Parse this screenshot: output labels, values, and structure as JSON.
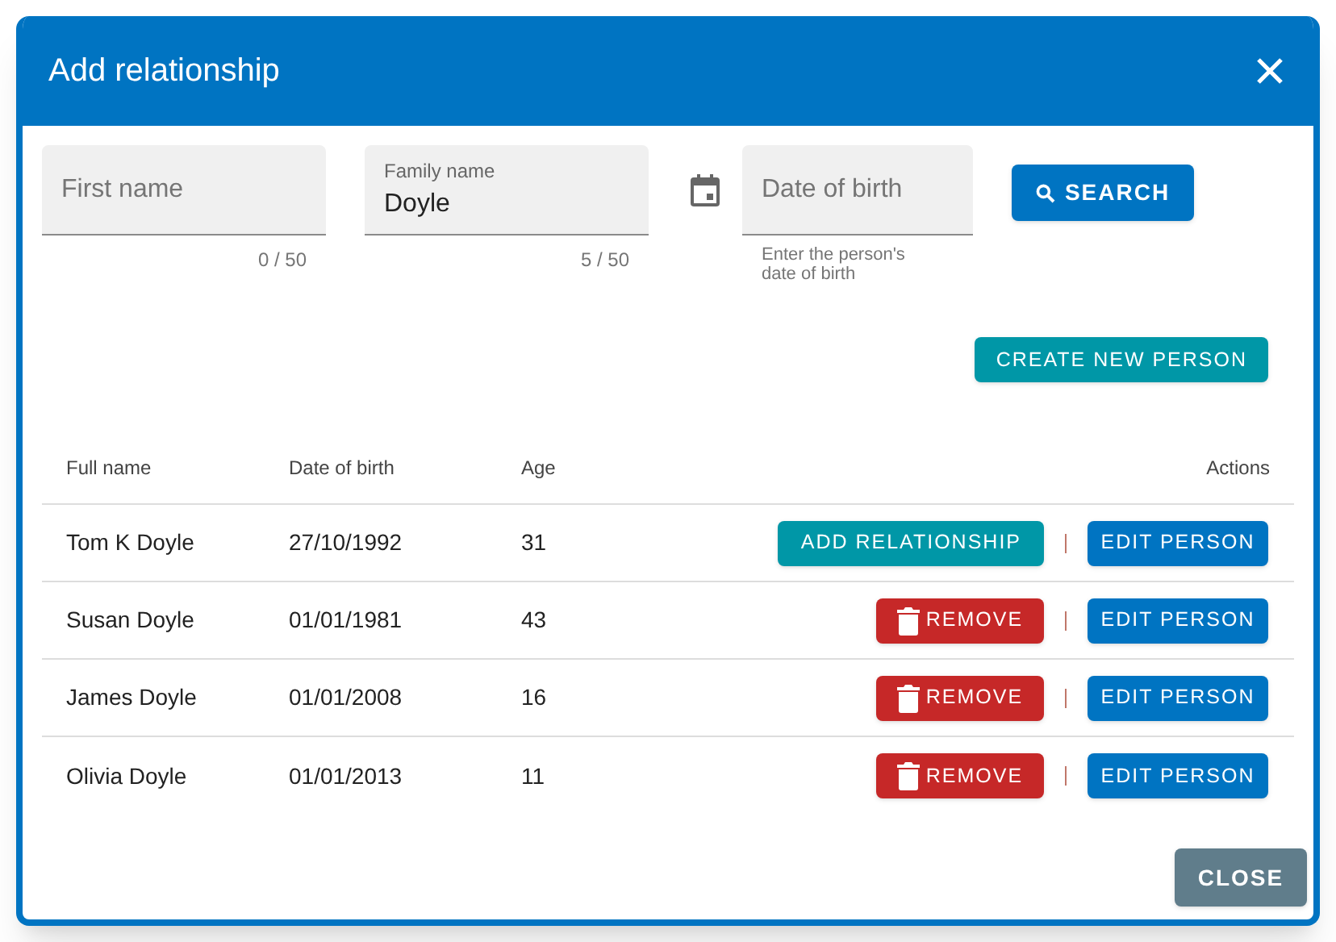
{
  "dialog": {
    "title": "Add relationship"
  },
  "search_form": {
    "first_name": {
      "placeholder": "First name",
      "counter": "0 / 50"
    },
    "family_name": {
      "label": "Family name",
      "value": "Doyle",
      "counter": "5 / 50"
    },
    "date_of_birth": {
      "placeholder": "Date of birth",
      "hint": "Enter the person's date of birth"
    },
    "search_button": "SEARCH"
  },
  "create_button": "CREATE NEW PERSON",
  "table": {
    "columns": [
      "Full name",
      "Date of birth",
      "Age",
      "Actions"
    ],
    "rows": [
      {
        "full_name": "Tom K Doyle",
        "date_of_birth": "27/10/1992",
        "age": "31",
        "action": {
          "kind": "add",
          "label": "ADD RELATIONSHIP"
        },
        "edit": "EDIT PERSON"
      },
      {
        "full_name": "Susan Doyle",
        "date_of_birth": "01/01/1981",
        "age": "43",
        "action": {
          "kind": "remove",
          "label": "REMOVE"
        },
        "edit": "EDIT PERSON"
      },
      {
        "full_name": "James Doyle",
        "date_of_birth": "01/01/2008",
        "age": "16",
        "action": {
          "kind": "remove",
          "label": "REMOVE"
        },
        "edit": "EDIT PERSON"
      },
      {
        "full_name": "Olivia Doyle",
        "date_of_birth": "01/01/2013",
        "age": "11",
        "action": {
          "kind": "remove",
          "label": "REMOVE"
        },
        "edit": "EDIT PERSON"
      }
    ]
  },
  "close_button": "CLOSE"
}
